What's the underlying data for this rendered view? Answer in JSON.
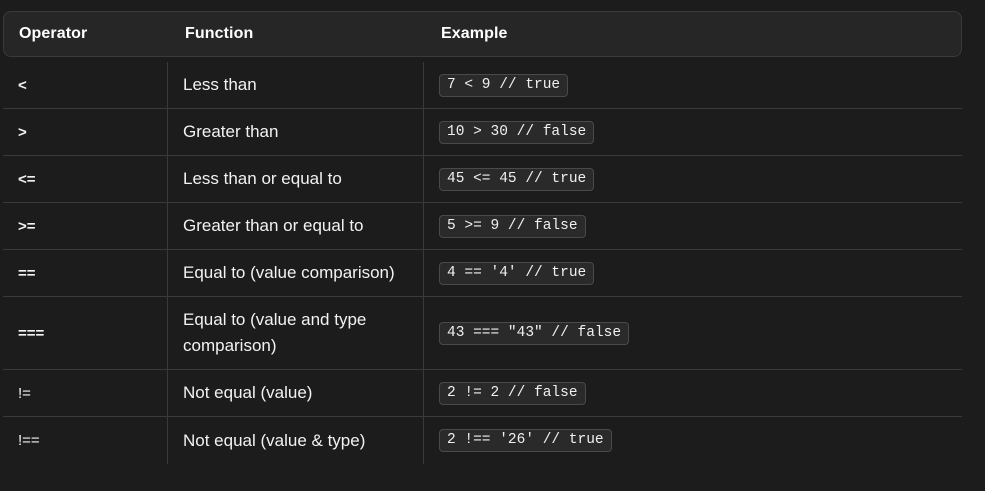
{
  "table": {
    "headers": {
      "operator": "Operator",
      "function": "Function",
      "example": "Example"
    },
    "rows": [
      {
        "operator": "<",
        "function": "Less than",
        "example": "7 < 9 // true"
      },
      {
        "operator": ">",
        "function": "Greater than",
        "example": "10 > 30 // false"
      },
      {
        "operator": "<=",
        "function": "Less than or equal to",
        "example": "45 <= 45 // true"
      },
      {
        "operator": ">=",
        "function": "Greater than or equal to",
        "example": "5 >= 9 // false"
      },
      {
        "operator": "==",
        "function": "Equal to (value comparison)",
        "example": "4 == '4' // true"
      },
      {
        "operator": "===",
        "function": "Equal to (value and type comparison)",
        "example": "43 === \"43\" // false"
      },
      {
        "operator": "!=",
        "function": "Not equal (value)",
        "example": "2 != 2 // false"
      },
      {
        "operator": "!==",
        "function": "Not equal (value & type)",
        "example": "2 !== '26' // true"
      }
    ]
  }
}
